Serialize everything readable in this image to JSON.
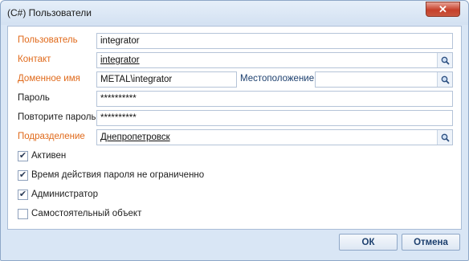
{
  "window": {
    "title": "(C#) Пользователи",
    "close_glyph": "✕"
  },
  "form": {
    "user": {
      "label": "Пользователь",
      "value": "integrator"
    },
    "contact": {
      "label": "Контакт",
      "value": "integrator"
    },
    "domain": {
      "label": "Доменное имя",
      "value": "METAL\\integrator"
    },
    "location": {
      "label": "Местоположение",
      "value": ""
    },
    "password": {
      "label": "Пароль",
      "value": "**********"
    },
    "password_repeat": {
      "label": "Повторите пароль",
      "value": "**********"
    },
    "department": {
      "label": "Подразделение",
      "value": "Днепропетровск"
    }
  },
  "checkboxes": [
    {
      "label": "Активен",
      "checked": true
    },
    {
      "label": "Время действия пароля не ограниченно",
      "checked": true
    },
    {
      "label": "Администратор",
      "checked": true
    },
    {
      "label": "Самостоятельный объект",
      "checked": false
    }
  ],
  "buttons": {
    "ok": "ОК",
    "cancel": "Отмена"
  },
  "colors": {
    "required_label": "#e06a1b",
    "frame": "#d9e6f5",
    "button_text": "#1c3f6e"
  }
}
